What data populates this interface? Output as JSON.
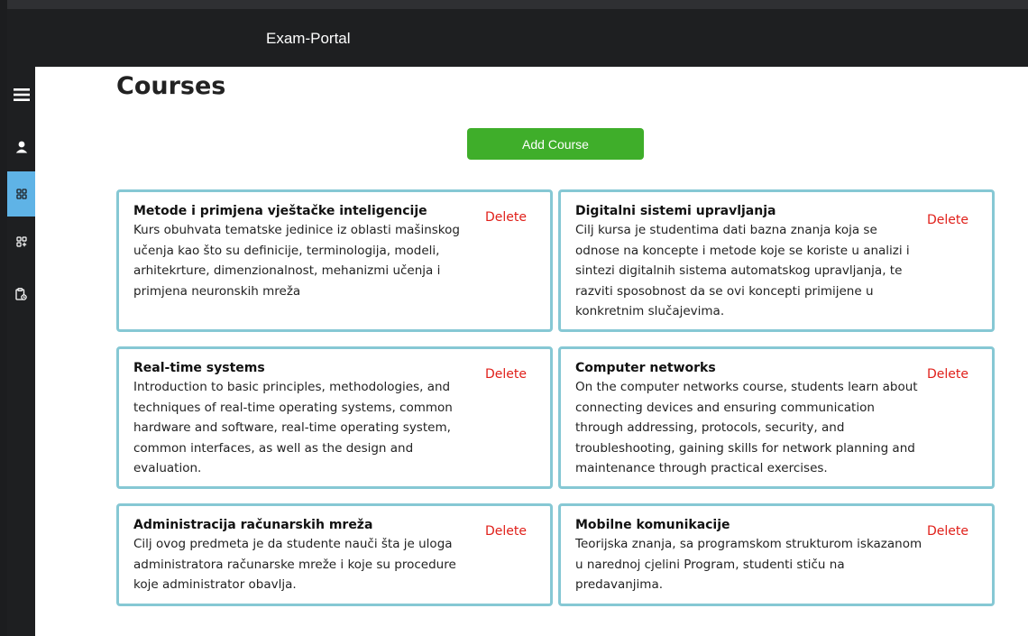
{
  "app": {
    "title": "Exam-Portal"
  },
  "page": {
    "title": "Courses",
    "add_button_label": "Add Course",
    "delete_label": "Delete"
  },
  "sidebar": {
    "items": [
      {
        "name": "menu",
        "icon": "hamburger-menu-icon",
        "active": false
      },
      {
        "name": "profile",
        "icon": "user-icon",
        "active": false
      },
      {
        "name": "courses",
        "icon": "grid-icon",
        "active": true
      },
      {
        "name": "add-course",
        "icon": "grid-plus-icon",
        "active": false
      },
      {
        "name": "quizzes",
        "icon": "clipboard-icon",
        "active": false
      }
    ]
  },
  "colors": {
    "accent_button": "#3fae2a",
    "card_border": "#86c8d4",
    "delete": "#e0201a",
    "sidebar_active": "#5fb3e6",
    "topbar": "#1e1f21"
  },
  "courses": [
    {
      "title": "Metode i primjena vještačke inteligencije",
      "description": "Kurs obuhvata tematske jedinice iz oblasti mašinskog učenja kao što su definicije, terminologija, modeli, arhitekrture, dimenzionalnost, mehanizmi učenja i primjena neuronskih mreža"
    },
    {
      "title": "Digitalni sistemi upravljanja",
      "description": "Cilj kursa je studentima dati bazna znanja koja se odnose na koncepte i metode koje se koriste u analizi i sintezi digitalnih sistema automatskog upravljanja, te razviti sposobnost da se ovi koncepti primijene u konkretnim slučajevima."
    },
    {
      "title": "Real-time systems",
      "description": "Introduction to basic principles, methodologies, and techniques of real-time operating systems, common hardware and software, real-time operating system, common interfaces, as well as the design and evaluation."
    },
    {
      "title": "Computer networks",
      "description": "On the computer networks course, students learn about connecting devices and ensuring communication through addressing, protocols, security, and troubleshooting, gaining skills for network planning and maintenance through practical exercises."
    },
    {
      "title": "Administracija računarskih mreža",
      "description": "Cilj ovog predmeta je da studente nauči šta je uloga administratora računarske mreže i koje su procedure koje administrator obavlja."
    },
    {
      "title": "Mobilne komunikacije",
      "description": "Teorijska znanja, sa programskom strukturom iskazanom u narednoj cjelini Program, studenti stiču na predavanjima."
    }
  ]
}
